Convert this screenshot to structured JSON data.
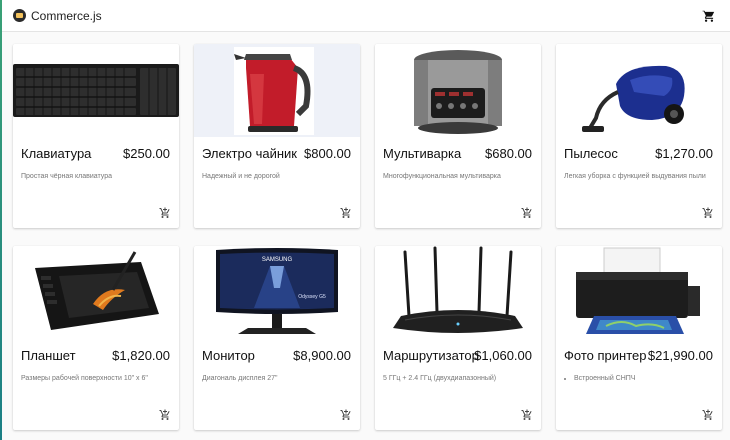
{
  "app": {
    "brand": "Commerce.js"
  },
  "products": [
    {
      "name": "Клавиатура",
      "price": "$250.00",
      "description": "Простая чёрная клавиатура",
      "image_icon": "keyboard-image"
    },
    {
      "name": "Электро чайник",
      "price": "$800.00",
      "description": "Надежный и не дорогой",
      "image_icon": "kettle-image"
    },
    {
      "name": "Мультиварка",
      "price": "$680.00",
      "description": "Многофункциональная мультиварка",
      "image_icon": "multicooker-image"
    },
    {
      "name": "Пылесос",
      "price": "$1,270.00",
      "description": "Легкая уборка с функцией выдувания пыли",
      "image_icon": "vacuum-image"
    },
    {
      "name": "Планшет",
      "price": "$1,820.00",
      "description": "Размеры рабочей поверхности 10\" x 6\"",
      "image_icon": "graphics-tablet-image"
    },
    {
      "name": "Монитор",
      "price": "$8,900.00",
      "description": "Диагональ дисплея 27\"",
      "image_icon": "monitor-image",
      "screen_text": [
        "SAMSUNG",
        "Odyssey G5"
      ]
    },
    {
      "name": "Маршрутизатор",
      "price": "$1,060.00",
      "description": "5 ГГц + 2.4 ГГц (двухдиапазонный)",
      "image_icon": "router-image"
    },
    {
      "name": "Фото принтер",
      "price": "$21,990.00",
      "description": "Встроенный СНПЧ",
      "description_bullet": true,
      "image_icon": "photo-printer-image"
    }
  ],
  "colors": {
    "accent": "#3aa176",
    "card_bg": "#ffffff",
    "page_bg": "#fafafa"
  }
}
